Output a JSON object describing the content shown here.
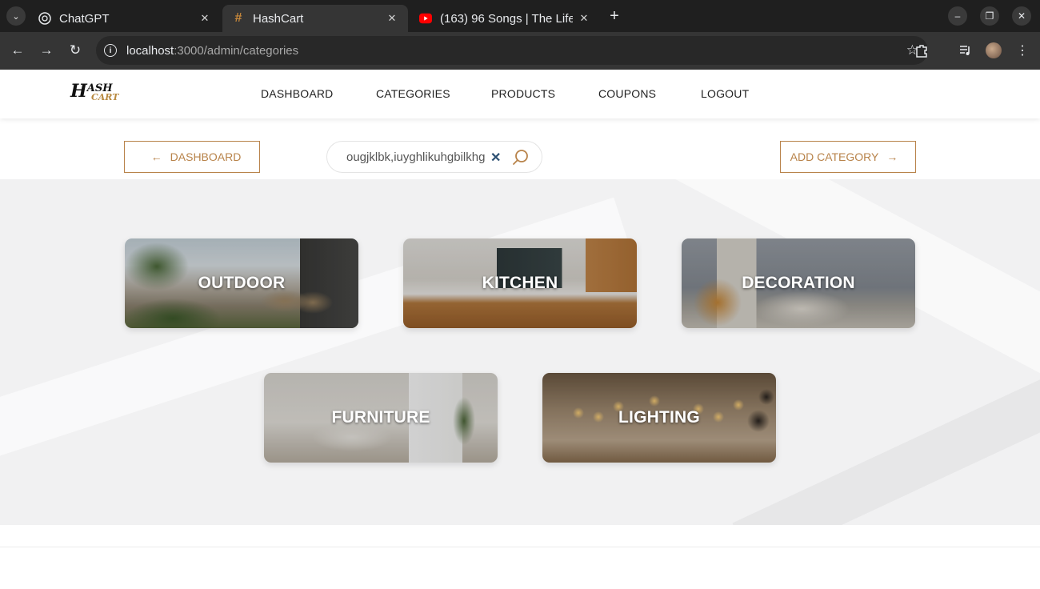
{
  "browser": {
    "tabs": [
      {
        "title": "ChatGPT",
        "favicon": "chatgpt-icon",
        "active": false
      },
      {
        "title": "HashCart",
        "favicon": "hash-icon",
        "active": true
      },
      {
        "title": "(163) 96 Songs | The Life",
        "favicon": "youtube-icon",
        "active": false
      }
    ],
    "url_host": "localhost",
    "url_rest": ":3000/admin/categories"
  },
  "site": {
    "logo": {
      "first": "H",
      "rest": "ASH",
      "sub": "CART"
    },
    "nav": [
      "DASHBOARD",
      "CATEGORIES",
      "PRODUCTS",
      "COUPONS",
      "LOGOUT"
    ]
  },
  "actions": {
    "back_label": "DASHBOARD",
    "back_arrow": "←",
    "add_label": "ADD CATEGORY",
    "add_arrow": "→",
    "search_value": "ougjklbk,iuyghlikuhgbilkhg"
  },
  "categories": [
    {
      "label": "OUTDOOR"
    },
    {
      "label": "KITCHEN"
    },
    {
      "label": "DECORATION"
    },
    {
      "label": "FURNITURE"
    },
    {
      "label": "LIGHTING"
    }
  ],
  "colors": {
    "accent": "#b8834a",
    "chrome_dark": "#1f1f1f",
    "chrome_toolbar": "#353535"
  }
}
